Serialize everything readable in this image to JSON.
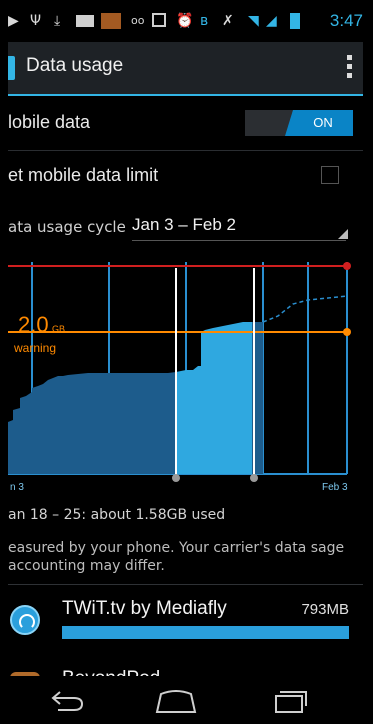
{
  "status_bar": {
    "icons": [
      "play-icon",
      "usb-icon",
      "download-icon",
      "gmail-icon",
      "notification-icon",
      "voicemail-icon",
      "calendar-icon",
      "alarm-icon",
      "bluetooth-icon",
      "vibrate-icon",
      "wifi-icon",
      "signal-icon",
      "battery-icon"
    ],
    "time": "3:47"
  },
  "action_bar": {
    "title": "Data usage",
    "app_icon": "settings-icon",
    "overflow_icon": "overflow-menu-icon"
  },
  "settings": {
    "mobile_data_label": "lobile data",
    "mobile_data_state": "ON",
    "limit_label": "et mobile data limit",
    "cycle_label": "ata usage cycle",
    "cycle_value": "Jan 3 – Feb 2"
  },
  "chart": {
    "warning_value": "2.0",
    "warning_unit": "GB",
    "warning_text": "warning",
    "axis_start": "n 3",
    "axis_end": "Feb 3",
    "colors": {
      "limit_line": "#d11f1f",
      "warning_line": "#ff8a00",
      "usage_fill": "#1d5c8c",
      "selected_fill": "#2fa8e0",
      "grid": "#2a8fd0",
      "marker": "#ffffff"
    }
  },
  "chart_data": {
    "type": "area",
    "title": "",
    "xlabel": "",
    "ylabel": "",
    "x_range": [
      "Jan 3",
      "Feb 3"
    ],
    "y_unit": "GB",
    "limit_line": "limit",
    "warning_line_gb": 2.0,
    "selected_range": [
      "Jan 18",
      "Jan 25"
    ],
    "series": [
      {
        "x": [
          0,
          1,
          2,
          3,
          4,
          5,
          6,
          7,
          8,
          9,
          10,
          11,
          12,
          13,
          14,
          15,
          16,
          17,
          18,
          19,
          20,
          21,
          22,
          23,
          24,
          25
        ],
        "y": [
          0.15,
          0.5,
          0.75,
          0.9,
          1.0,
          1.1,
          1.18,
          1.22,
          1.25,
          1.27,
          1.28,
          1.29,
          1.3,
          1.3,
          1.3,
          1.3,
          1.35,
          1.45,
          1.95,
          2.05,
          2.07,
          2.08,
          2.1,
          2.2,
          2.3,
          2.4
        ]
      }
    ]
  },
  "summary": {
    "usage_text": "an 18 – 25: about 1.58GB used",
    "note": "easured by your phone. Your carrier's data sage accounting may differ."
  },
  "apps": [
    {
      "name": "TWiT.tv by Mediafly",
      "size": "793MB",
      "usage_fraction": 1.0,
      "icon": "twit-app-icon"
    },
    {
      "name": "BeyondPod",
      "icon": "beyondpod-app-icon"
    }
  ],
  "nav_bar": {
    "back_icon": "back-icon",
    "home_icon": "home-icon",
    "recents_icon": "recent-apps-icon"
  }
}
